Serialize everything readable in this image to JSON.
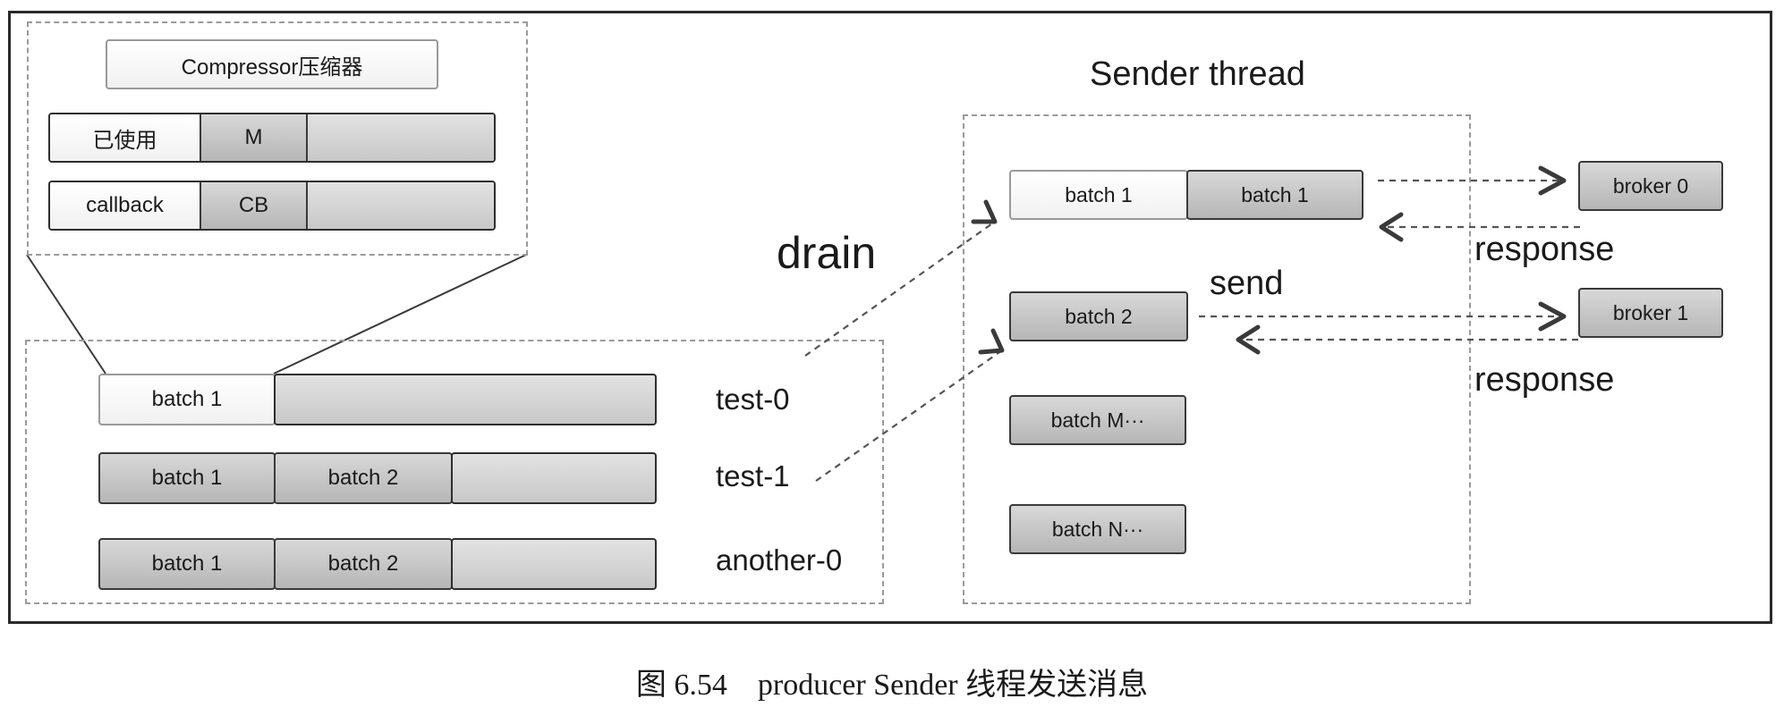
{
  "diagram": {
    "compressor_label": "Compressor压缩器",
    "used_row": {
      "label": "已使用",
      "value": "M"
    },
    "callback_row": {
      "label": "callback",
      "value": "CB"
    },
    "sender_title": "Sender thread",
    "drain_label": "drain",
    "send_label": "send",
    "partitions": [
      {
        "name": "test-0",
        "batches": [
          "batch 1"
        ]
      },
      {
        "name": "test-1",
        "batches": [
          "batch 1",
          "batch 2"
        ]
      },
      {
        "name": "another-0",
        "batches": [
          "batch 1",
          "batch 2"
        ]
      }
    ],
    "sender_batches": {
      "row1_left": "batch 1",
      "row1_right": "batch 1",
      "row2": "batch 2",
      "row3": "batch M···",
      "row4": "batch N···"
    },
    "brokers": [
      "broker 0",
      "broker 1"
    ],
    "response_labels": [
      "response",
      "response"
    ]
  },
  "caption": {
    "figure_number": "图 6.54",
    "text": "producer Sender 线程发送消息"
  }
}
